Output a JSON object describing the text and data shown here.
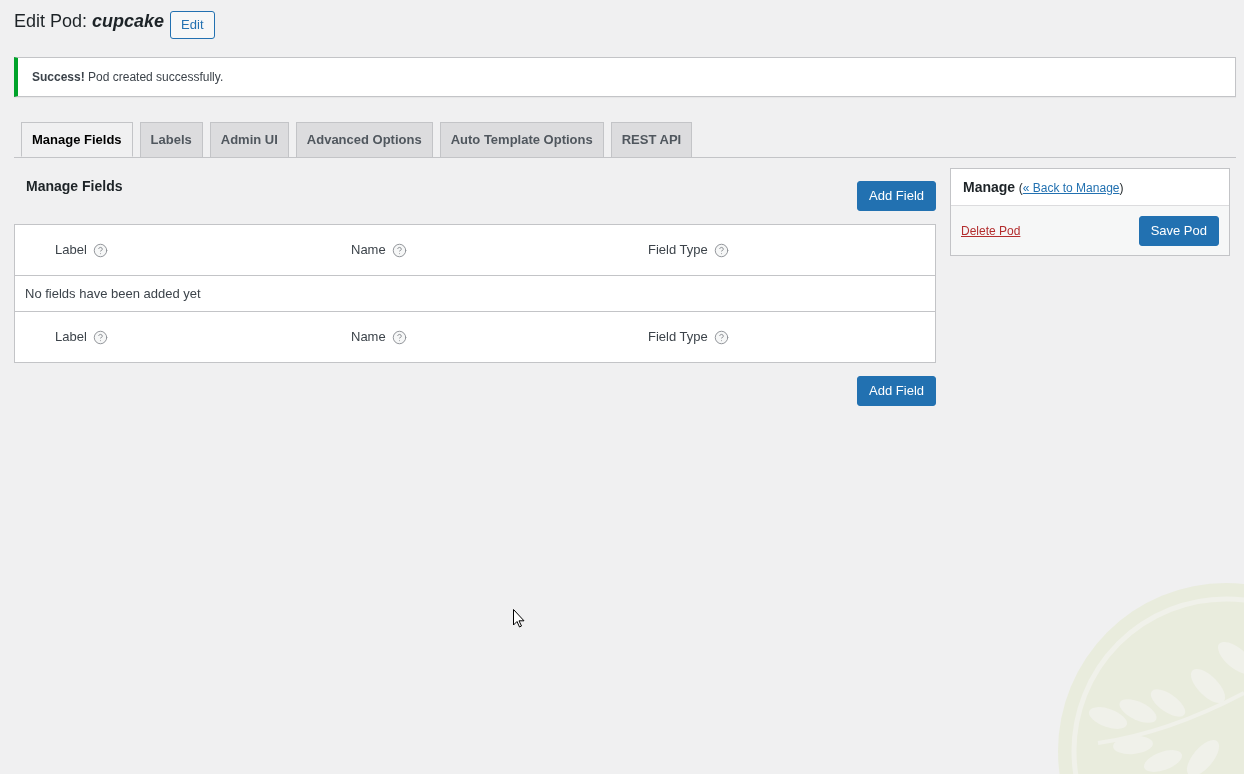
{
  "header": {
    "title": "Edit Pod: *cupcake*",
    "edit_button": "Edit"
  },
  "notice": {
    "message": "**Success!** Pod created successfully."
  },
  "tabs": [
    {
      "label": "Manage Fields",
      "selected": true
    },
    {
      "label": "Labels",
      "selected": false
    },
    {
      "label": "Admin UI",
      "selected": false
    },
    {
      "label": "Advanced Options",
      "selected": false
    },
    {
      "label": "Auto Template Options",
      "selected": false
    },
    {
      "label": "REST API",
      "selected": false
    }
  ],
  "fields_section": {
    "heading": "Manage Fields",
    "add_button_top": "Add Field",
    "table": {
      "header_columns": [
        "Label",
        "Name",
        "Field Type"
      ],
      "empty_message": "No fields have been added yet",
      "footer_columns": [
        "Label",
        "Name",
        "Field Type"
      ]
    },
    "add_button_bottom": "Add Field"
  },
  "manage_box": {
    "title": "Manage",
    "link_prefix": "(",
    "link": "« Back to Manage",
    "link_suffix": ")",
    "delete_link": "Delete Pod",
    "save_button": "Save Pod"
  }
}
